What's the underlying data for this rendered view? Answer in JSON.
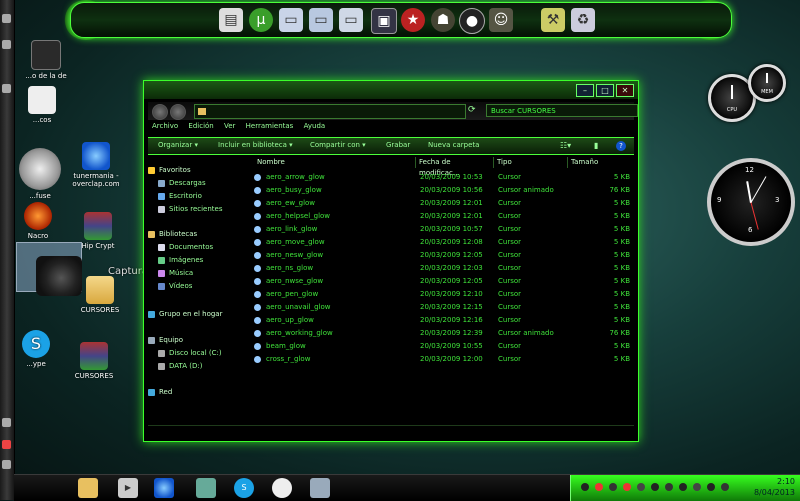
{
  "desktop": {
    "icons": [
      {
        "label": "...o de\nla de",
        "name": "desktop-icon-top"
      },
      {
        "label": "...cos",
        "name": "desktop-icon-docs"
      },
      {
        "label": "...fuse",
        "name": "desktop-icon-fuse"
      },
      {
        "label": "tunermania - overclap.com",
        "name": "desktop-icon-tunermania"
      },
      {
        "label": "Nacro",
        "name": "desktop-icon-nacro"
      },
      {
        "label": "Hip Crypt",
        "name": "desktop-icon-hipcrypt"
      },
      {
        "label": "Captura de Pantalla",
        "name": "desktop-icon-captura"
      },
      {
        "label": "CURSORES",
        "name": "desktop-icon-cursores-folder"
      },
      {
        "label": "...ype",
        "name": "desktop-icon-skype"
      },
      {
        "label": "CURSORES",
        "name": "desktop-icon-cursores-rar"
      }
    ]
  },
  "window": {
    "title": "",
    "controls": {
      "minimize": "–",
      "maximize": "□",
      "close": "✕"
    },
    "search_placeholder": "Buscar CURSORES",
    "menu": [
      "Archivo",
      "Edición",
      "Ver",
      "Herramientas",
      "Ayuda"
    ],
    "toolbar": {
      "organize": "Organizar ▾",
      "include": "Incluir en biblioteca ▾",
      "share": "Compartir con ▾",
      "burn": "Grabar",
      "new_folder": "Nueva carpeta"
    },
    "nav": {
      "favorites": "Favoritos",
      "fav_items": [
        "Descargas",
        "Escritorio",
        "Sitios recientes"
      ],
      "libraries": "Bibliotecas",
      "lib_items": [
        "Documentos",
        "Imágenes",
        "Música",
        "Vídeos"
      ],
      "homegroup": "Grupo en el hogar",
      "computer": "Equipo",
      "comp_items": [
        "Disco local (C:)",
        "DATA (D:)"
      ],
      "network": "Red"
    },
    "columns": [
      "Nombre",
      "Fecha de modificac...",
      "Tipo",
      "Tamaño"
    ],
    "files": [
      {
        "name": "aero_arrow_glow",
        "date": "20/03/2009 10:53",
        "type": "Cursor",
        "size": "5 KB"
      },
      {
        "name": "aero_busy_glow",
        "date": "20/03/2009 10:56",
        "type": "Cursor animado",
        "size": "76 KB"
      },
      {
        "name": "aero_ew_glow",
        "date": "20/03/2009 12:01",
        "type": "Cursor",
        "size": "5 KB"
      },
      {
        "name": "aero_helpsel_glow",
        "date": "20/03/2009 12:01",
        "type": "Cursor",
        "size": "5 KB"
      },
      {
        "name": "aero_link_glow",
        "date": "20/03/2009 10:57",
        "type": "Cursor",
        "size": "5 KB"
      },
      {
        "name": "aero_move_glow",
        "date": "20/03/2009 12:08",
        "type": "Cursor",
        "size": "5 KB"
      },
      {
        "name": "aero_nesw_glow",
        "date": "20/03/2009 12:05",
        "type": "Cursor",
        "size": "5 KB"
      },
      {
        "name": "aero_ns_glow",
        "date": "20/03/2009 12:03",
        "type": "Cursor",
        "size": "5 KB"
      },
      {
        "name": "aero_nwse_glow",
        "date": "20/03/2009 12:05",
        "type": "Cursor",
        "size": "5 KB"
      },
      {
        "name": "aero_pen_glow",
        "date": "20/03/2009 12:10",
        "type": "Cursor",
        "size": "5 KB"
      },
      {
        "name": "aero_unavail_glow",
        "date": "20/03/2009 12:15",
        "type": "Cursor",
        "size": "5 KB"
      },
      {
        "name": "aero_up_glow",
        "date": "20/03/2009 12:16",
        "type": "Cursor",
        "size": "5 KB"
      },
      {
        "name": "aero_working_glow",
        "date": "20/03/2009 12:39",
        "type": "Cursor animado",
        "size": "76 KB"
      },
      {
        "name": "beam_glow",
        "date": "20/03/2009 10:55",
        "type": "Cursor",
        "size": "5 KB"
      },
      {
        "name": "cross_r_glow",
        "date": "20/03/2009 12:00",
        "type": "Cursor",
        "size": "5 KB"
      }
    ]
  },
  "gadgets": {
    "cpu_label": "CPU",
    "mem_label": "MEM",
    "clock_numbers": [
      "12",
      "3",
      "6",
      "9"
    ]
  },
  "taskbar": {
    "time": "2:10",
    "date": "8/04/2013"
  },
  "colors": {
    "accent": "#3dff2a",
    "file_text": "#3fe33a",
    "tray": "#2fd61f"
  }
}
